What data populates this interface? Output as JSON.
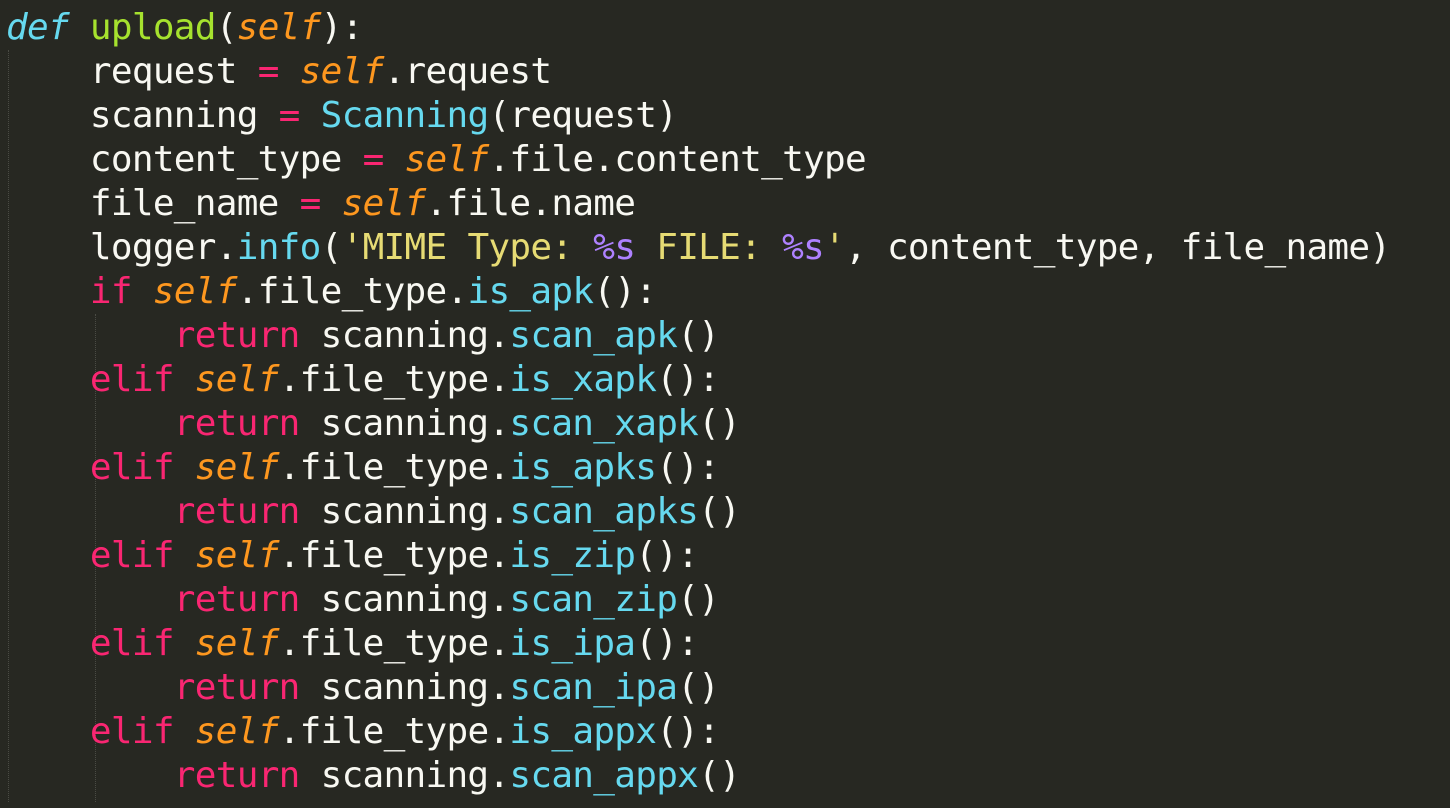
{
  "editor": {
    "theme": "Monokai",
    "colors": {
      "background": "#272822",
      "text": "#f8f8f2",
      "keyword": "#f92672",
      "storage": "#66d9ef",
      "function": "#a6e22e",
      "parameter": "#fd971f",
      "support": "#66d9ef",
      "string": "#e6db74",
      "placeholder": "#ae81ff"
    },
    "lines": [
      [
        {
          "t": "def",
          "c": "storage",
          "i": true
        },
        {
          "t": " "
        },
        {
          "t": "upload",
          "c": "function"
        },
        {
          "t": "("
        },
        {
          "t": "self",
          "c": "parameter",
          "i": true
        },
        {
          "t": "):"
        }
      ],
      [
        {
          "t": "    request "
        },
        {
          "t": "=",
          "c": "keyword"
        },
        {
          "t": " "
        },
        {
          "t": "self",
          "c": "parameter",
          "i": true
        },
        {
          "t": ".request"
        }
      ],
      [
        {
          "t": "    scanning "
        },
        {
          "t": "=",
          "c": "keyword"
        },
        {
          "t": " "
        },
        {
          "t": "Scanning",
          "c": "support"
        },
        {
          "t": "(request)"
        }
      ],
      [
        {
          "t": "    content_type "
        },
        {
          "t": "=",
          "c": "keyword"
        },
        {
          "t": " "
        },
        {
          "t": "self",
          "c": "parameter",
          "i": true
        },
        {
          "t": ".file.content_type"
        }
      ],
      [
        {
          "t": "    file_name "
        },
        {
          "t": "=",
          "c": "keyword"
        },
        {
          "t": " "
        },
        {
          "t": "self",
          "c": "parameter",
          "i": true
        },
        {
          "t": ".file.name"
        }
      ],
      [
        {
          "t": "    logger."
        },
        {
          "t": "info",
          "c": "support"
        },
        {
          "t": "("
        },
        {
          "t": "'MIME Type: ",
          "c": "string"
        },
        {
          "t": "%s",
          "c": "placeholder"
        },
        {
          "t": " FILE: ",
          "c": "string"
        },
        {
          "t": "%s",
          "c": "placeholder"
        },
        {
          "t": "'",
          "c": "string"
        },
        {
          "t": ", content_type, file_name)"
        }
      ],
      [
        {
          "t": "    "
        },
        {
          "t": "if",
          "c": "keyword"
        },
        {
          "t": " "
        },
        {
          "t": "self",
          "c": "parameter",
          "i": true
        },
        {
          "t": ".file_type."
        },
        {
          "t": "is_apk",
          "c": "support"
        },
        {
          "t": "():"
        }
      ],
      [
        {
          "t": "        "
        },
        {
          "t": "return",
          "c": "keyword"
        },
        {
          "t": " scanning."
        },
        {
          "t": "scan_apk",
          "c": "support"
        },
        {
          "t": "()"
        }
      ],
      [
        {
          "t": "    "
        },
        {
          "t": "elif",
          "c": "keyword"
        },
        {
          "t": " "
        },
        {
          "t": "self",
          "c": "parameter",
          "i": true
        },
        {
          "t": ".file_type."
        },
        {
          "t": "is_xapk",
          "c": "support"
        },
        {
          "t": "():"
        }
      ],
      [
        {
          "t": "        "
        },
        {
          "t": "return",
          "c": "keyword"
        },
        {
          "t": " scanning."
        },
        {
          "t": "scan_xapk",
          "c": "support"
        },
        {
          "t": "()"
        }
      ],
      [
        {
          "t": "    "
        },
        {
          "t": "elif",
          "c": "keyword"
        },
        {
          "t": " "
        },
        {
          "t": "self",
          "c": "parameter",
          "i": true
        },
        {
          "t": ".file_type."
        },
        {
          "t": "is_apks",
          "c": "support"
        },
        {
          "t": "():"
        }
      ],
      [
        {
          "t": "        "
        },
        {
          "t": "return",
          "c": "keyword"
        },
        {
          "t": " scanning."
        },
        {
          "t": "scan_apks",
          "c": "support"
        },
        {
          "t": "()"
        }
      ],
      [
        {
          "t": "    "
        },
        {
          "t": "elif",
          "c": "keyword"
        },
        {
          "t": " "
        },
        {
          "t": "self",
          "c": "parameter",
          "i": true
        },
        {
          "t": ".file_type."
        },
        {
          "t": "is_zip",
          "c": "support"
        },
        {
          "t": "():"
        }
      ],
      [
        {
          "t": "        "
        },
        {
          "t": "return",
          "c": "keyword"
        },
        {
          "t": " scanning."
        },
        {
          "t": "scan_zip",
          "c": "support"
        },
        {
          "t": "()"
        }
      ],
      [
        {
          "t": "    "
        },
        {
          "t": "elif",
          "c": "keyword"
        },
        {
          "t": " "
        },
        {
          "t": "self",
          "c": "parameter",
          "i": true
        },
        {
          "t": ".file_type."
        },
        {
          "t": "is_ipa",
          "c": "support"
        },
        {
          "t": "():"
        }
      ],
      [
        {
          "t": "        "
        },
        {
          "t": "return",
          "c": "keyword"
        },
        {
          "t": " scanning."
        },
        {
          "t": "scan_ipa",
          "c": "support"
        },
        {
          "t": "()"
        }
      ],
      [
        {
          "t": "    "
        },
        {
          "t": "elif",
          "c": "keyword"
        },
        {
          "t": " "
        },
        {
          "t": "self",
          "c": "parameter",
          "i": true
        },
        {
          "t": ".file_type."
        },
        {
          "t": "is_appx",
          "c": "support"
        },
        {
          "t": "():"
        }
      ],
      [
        {
          "t": "        "
        },
        {
          "t": "return",
          "c": "keyword"
        },
        {
          "t": " scanning."
        },
        {
          "t": "scan_appx",
          "c": "support"
        },
        {
          "t": "()"
        }
      ]
    ]
  }
}
